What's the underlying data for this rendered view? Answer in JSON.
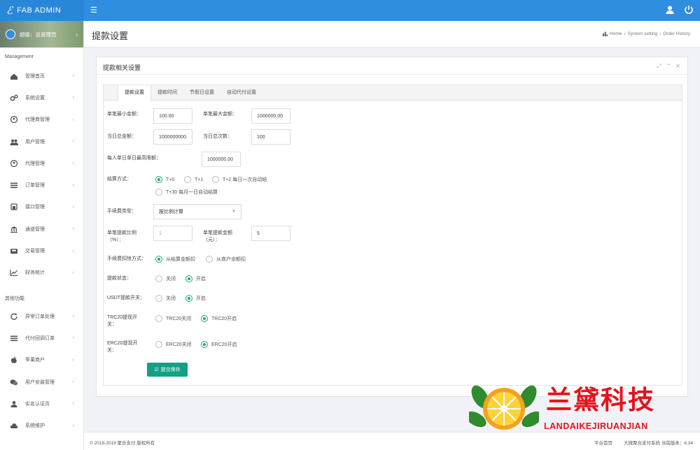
{
  "brand": {
    "name": "FAB ADMIN"
  },
  "topbar": {
    "menu_icon": "☰"
  },
  "user_panel": {
    "name": "超级：总管理员"
  },
  "sidebar": {
    "sections": [
      {
        "title": "Management",
        "items": [
          {
            "label": "管理首页",
            "icon": "home-icon"
          },
          {
            "label": "系统设置",
            "icon": "gears-icon"
          },
          {
            "label": "代理商管理",
            "icon": "user-circle-icon"
          },
          {
            "label": "用户管理",
            "icon": "users-icon"
          },
          {
            "label": "代理管理",
            "icon": "user-circle-icon"
          },
          {
            "label": "订单管理",
            "icon": "list-icon"
          },
          {
            "label": "接口管理",
            "icon": "bank-icon"
          },
          {
            "label": "通道管理",
            "icon": "institution-icon"
          },
          {
            "label": "交易管理",
            "icon": "inbox-icon"
          },
          {
            "label": "财务统计",
            "icon": "chart-icon"
          }
        ]
      },
      {
        "title": "其他功能",
        "items": [
          {
            "label": "异常订单处理",
            "icon": "refresh-icon"
          },
          {
            "label": "代付回调订单",
            "icon": "list-icon"
          },
          {
            "label": "苹果商户",
            "icon": "apple-icon"
          },
          {
            "label": "用户安装管理",
            "icon": "wechat-icon"
          },
          {
            "label": "实名认证页",
            "icon": "user-icon"
          },
          {
            "label": "系统维护",
            "icon": "cloud-icon"
          }
        ]
      }
    ]
  },
  "page": {
    "title": "提款设置"
  },
  "breadcrumb": [
    "Home",
    "System setting",
    "Order History"
  ],
  "panel": {
    "title": "提款相关设置"
  },
  "tabs": [
    "提款设置",
    "提款时间",
    "节假日设置",
    "自动代付设置"
  ],
  "form": {
    "min_single_label": "单笔最小金额：",
    "min_single_value": "100.00",
    "max_single_label": "单笔最大金额：",
    "max_single_value": "1000000.00",
    "daily_total_label": "当日总金额：",
    "daily_total_value": "1000000000.0",
    "daily_count_label": "当日总次数：",
    "daily_count_value": "100",
    "cap_label": "每人单日单日最高限额：",
    "cap_value": "1000000.00",
    "settle_label": "结算方式：",
    "settle_options": [
      "T+0",
      "T+1",
      "T+2 每日一次自动结",
      "T+30 每月一日自动结算"
    ],
    "fee_type_label": "手续费类型：",
    "fee_type_value": "按比例计算",
    "fee_rate_label": "单笔提款比例（%）：",
    "fee_rate_value": "1",
    "fee_amount_label": "单笔提款金额（元）：",
    "fee_amount_value": "5",
    "deduct_label": "手续费扣除方式：",
    "deduct_options": [
      "从结算金额扣",
      "从商户余额扣"
    ],
    "switch_label": "提款状态：",
    "switch_options": [
      "关闭",
      "开启"
    ],
    "usdt_label": "USDT提款开关：",
    "usdt_options": [
      "关闭",
      "开启"
    ],
    "trc_label": "TRC20提现开关：",
    "trc_options": [
      "TRC20关闭",
      "TRC20开启"
    ],
    "erc_label": "ERC20提现开关：",
    "erc_options": [
      "ERC20关闭",
      "ERC20开启"
    ],
    "save_label": "提交保存"
  },
  "footer": {
    "copyright": "© 2018-2019 聚合支付 版权所有",
    "home_link": "平台首页",
    "version": "大微聚合支付系统 当前版本：6.34"
  },
  "watermark": {
    "cn": "兰黛科技",
    "en": "LANDAIKEJIRUANJIAN"
  },
  "colors": {
    "primary": "#2f8ee0",
    "accent": "#14a083",
    "brand_red": "#e5121b"
  }
}
